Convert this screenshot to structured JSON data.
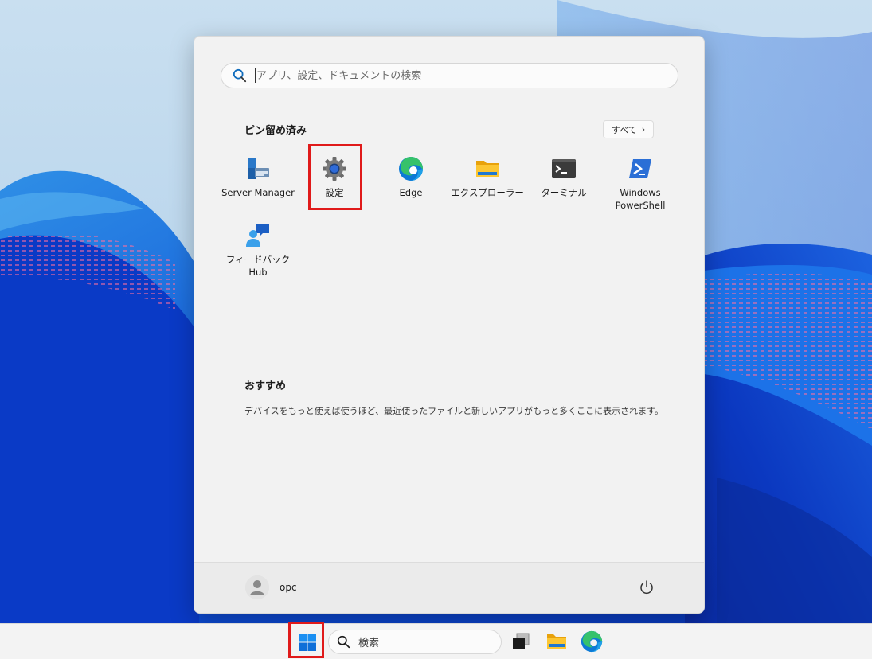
{
  "start_menu": {
    "search": {
      "placeholder": "アプリ、設定、ドキュメントの検索"
    },
    "pinned": {
      "title": "ピン留め済み",
      "all_button": "すべて",
      "apps": [
        {
          "label": "Server Manager",
          "icon": "server-manager-icon"
        },
        {
          "label": "設定",
          "icon": "settings-gear-icon"
        },
        {
          "label": "Edge",
          "icon": "edge-icon"
        },
        {
          "label": "エクスプローラー",
          "icon": "folder-icon"
        },
        {
          "label": "ターミナル",
          "icon": "terminal-icon"
        },
        {
          "label": "Windows\nPowerShell",
          "icon": "powershell-icon"
        },
        {
          "label": "フィードバック Hub",
          "icon": "feedback-hub-icon"
        }
      ]
    },
    "recommended": {
      "title": "おすすめ",
      "text": "デバイスをもっと使えば使うほど、最近使ったファイルと新しいアプリがもっと多くここに表示されます。"
    },
    "user": {
      "name": "opc"
    }
  },
  "taskbar": {
    "search_label": "検索",
    "icons": [
      "windows-start-icon",
      "search-icon",
      "task-view-icon",
      "file-explorer-icon",
      "edge-icon"
    ]
  },
  "colors": {
    "highlight": "#e01a1a",
    "accent": "#0067c0",
    "wallpaper_blue": "#0e44c8"
  }
}
